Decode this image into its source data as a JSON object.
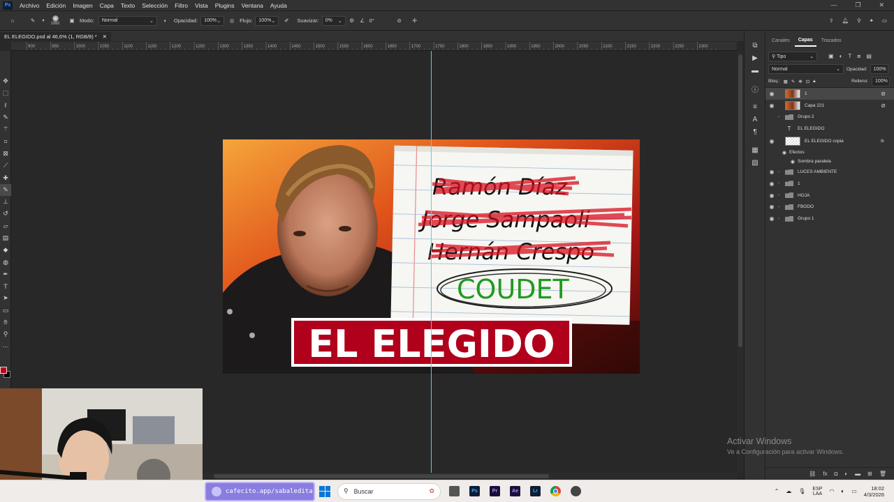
{
  "menubar": {
    "items": [
      "Archivo",
      "Edición",
      "Imagen",
      "Capa",
      "Texto",
      "Selección",
      "Filtro",
      "Vista",
      "Plugins",
      "Ventana",
      "Ayuda"
    ]
  },
  "options": {
    "brush_size": "1993",
    "mode_label": "Modo:",
    "mode_value": "Normal",
    "opacity_label": "Opacidad:",
    "opacity_value": "100%",
    "flow_label": "Flujo:",
    "flow_value": "100%",
    "smooth_label": "Suavizar:",
    "smooth_value": "0%",
    "angle_value": "0°"
  },
  "document": {
    "tab_title": "EL ELEGIDO.psd al 46,6% (1, RGB/8) *"
  },
  "ruler_ticks": [
    "900",
    "950",
    "1000",
    "1050",
    "1100",
    "1150",
    "1200",
    "1250",
    "1300",
    "1350",
    "1400",
    "1450",
    "1500",
    "1550",
    "1600",
    "1650",
    "1700",
    "1750",
    "1800",
    "1850",
    "1900",
    "1950",
    "2000",
    "2050",
    "2100",
    "2150",
    "2200",
    "2250",
    "2300"
  ],
  "artwork": {
    "names": [
      "Ramón Díaz",
      "Jorge Sampaoli",
      "Hernán Crespo"
    ],
    "highlight": "COUDET",
    "banner": "EL ELEGIDO"
  },
  "layers_panel": {
    "tabs": [
      "Canales",
      "Capas",
      "Trazados"
    ],
    "filter_label": "Tipo",
    "blend_mode": "Normal",
    "opacity_label": "Opacidad:",
    "opacity_value": "100%",
    "lock_label": "Bloq.:",
    "fill_label": "Relleno:",
    "fill_value": "100%",
    "layers": [
      {
        "name": "1",
        "kind": "image",
        "visible": true,
        "selected": true
      },
      {
        "name": "Capa 221",
        "kind": "image",
        "visible": true
      },
      {
        "name": "Grupo 2",
        "kind": "group",
        "visible": false
      },
      {
        "name": "EL ELEGIDO",
        "kind": "text",
        "visible": false
      },
      {
        "name": "EL ELEGIDO copia",
        "kind": "transparent",
        "visible": true,
        "fx": "fx"
      },
      {
        "name": "Efectos",
        "kind": "effects",
        "visible": true
      },
      {
        "name": "Sombra paralela",
        "kind": "effect",
        "visible": true
      },
      {
        "name": "LUCES AMBIENTE",
        "kind": "group",
        "visible": true
      },
      {
        "name": "1",
        "kind": "group",
        "visible": true
      },
      {
        "name": "HOJA",
        "kind": "group",
        "visible": true
      },
      {
        "name": "FBODO",
        "kind": "group",
        "visible": true
      },
      {
        "name": "Grupo 1",
        "kind": "group",
        "visible": true
      }
    ]
  },
  "watermark": {
    "line1": "Activar Windows",
    "line2": "Ve a Configuración para activar Windows."
  },
  "taskbar": {
    "promo": "cafecito.app/sabaledita",
    "search_placeholder": "Buscar",
    "lang_top": "ESP",
    "lang_bottom": "LAA",
    "time": "18:02",
    "date": "4/3/2026"
  },
  "colors": {
    "foreground": "#c0001a",
    "background": "#000000",
    "guide": "#4fd7e0",
    "banner_red": "#b0001c",
    "highlight_green": "#1f9a1f"
  }
}
